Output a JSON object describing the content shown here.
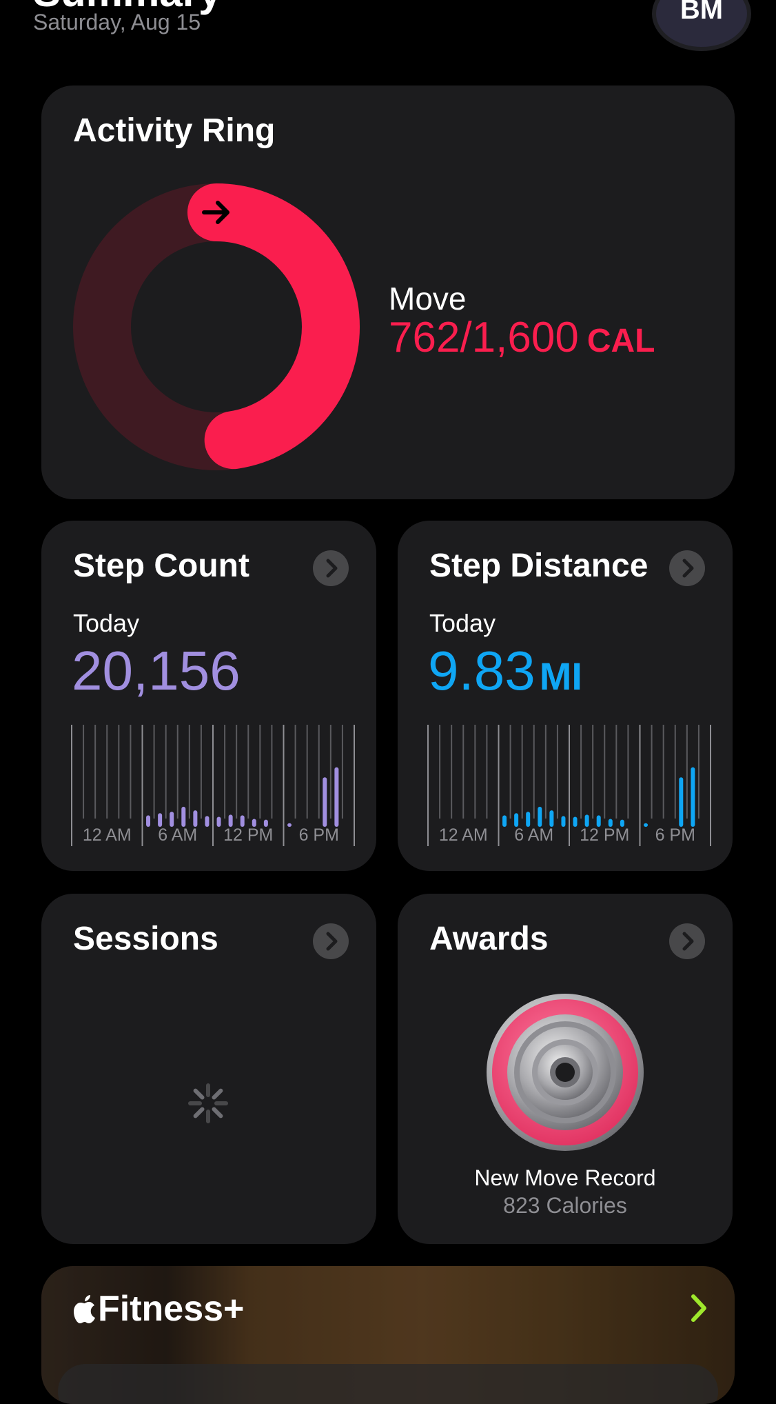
{
  "header": {
    "title": "Summary",
    "date": "Saturday, Aug 15",
    "avatar_initials": "BM"
  },
  "activity_ring": {
    "title": "Activity Ring",
    "move_label": "Move",
    "move_value": "762/1,600",
    "move_unit": "CAL",
    "progress": 0.476,
    "color": "#fa1e4e",
    "track_color": "#3f1a22"
  },
  "step_count": {
    "title": "Step Count",
    "period": "Today",
    "value": "20,156",
    "color": "#a18fe0",
    "ticks": [
      "12 AM",
      "6 AM",
      "12 PM",
      "6 PM"
    ],
    "hourly_bars": [
      0,
      0,
      0,
      0,
      0,
      0,
      0.32,
      0.38,
      0.42,
      0.56,
      0.46,
      0.3,
      0.28,
      0.34,
      0.32,
      0.22,
      0.2,
      0,
      0.1,
      0,
      0,
      1.38,
      1.66,
      0
    ]
  },
  "step_distance": {
    "title": "Step Distance",
    "period": "Today",
    "value": "9.83",
    "unit": "MI",
    "color": "#0fa6f4",
    "ticks": [
      "12 AM",
      "6 AM",
      "12 PM",
      "6 PM"
    ],
    "hourly_bars": [
      0,
      0,
      0,
      0,
      0,
      0,
      0.32,
      0.38,
      0.42,
      0.56,
      0.46,
      0.3,
      0.28,
      0.34,
      0.32,
      0.22,
      0.2,
      0,
      0.1,
      0,
      0,
      1.38,
      1.66,
      0
    ]
  },
  "sessions": {
    "title": "Sessions"
  },
  "awards": {
    "title": "Awards",
    "award_name": "New Move Record",
    "award_detail": "823 Calories"
  },
  "fitness_plus": {
    "title": "Fitness+",
    "logo": "apple-logo-icon",
    "accent": "#9fe82c"
  }
}
